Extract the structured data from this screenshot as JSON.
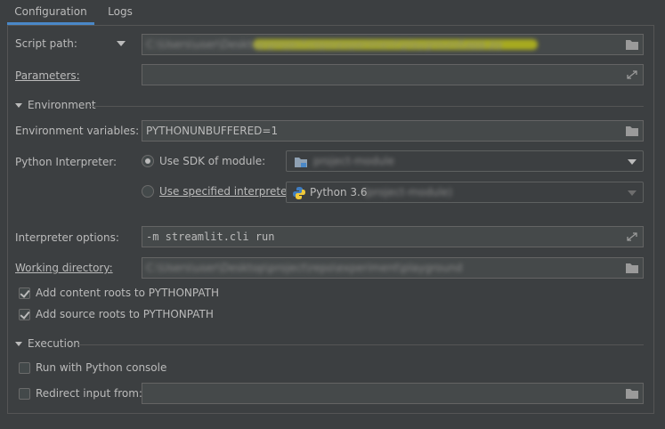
{
  "tabs": [
    {
      "label": "Configuration",
      "active": true
    },
    {
      "label": "Logs",
      "active": false
    }
  ],
  "script": {
    "label": "Script path:",
    "value": "C:\\Users\\user\\Desktop\\project\\repo\\experiment\\playground\\app.py"
  },
  "parameters": {
    "label": "Parameters:",
    "value": ""
  },
  "environment": {
    "title": "Environment",
    "env_vars_label": "Environment variables:",
    "env_vars_value": "PYTHONUNBUFFERED=1",
    "interpreter_label": "Python Interpreter:",
    "use_sdk_label": "Use SDK of module:",
    "module_value": "project-module",
    "use_specified_label": "Use specified interpreter:",
    "interpreter_value": "Python 3.6",
    "interpreter_value_suffix": "(project-module)",
    "interp_options_label": "Interpreter options:",
    "interp_options_value": "-m streamlit.cli run",
    "working_dir_label": "Working directory:",
    "working_dir_value": "C:\\Users\\user\\Desktop\\project\\repo\\experiment\\playground",
    "add_content_roots_label": "Add content roots to PYTHONPATH",
    "add_source_roots_label": "Add source roots to PYTHONPATH"
  },
  "execution": {
    "title": "Execution",
    "run_console_label": "Run with Python console",
    "redirect_label": "Redirect input from:",
    "redirect_value": ""
  },
  "colors": {
    "background": "#3c3f41",
    "field_bg": "#45494a",
    "accent": "#4a88c7",
    "text": "#bbbbbb",
    "highlight": "#cfd41c"
  }
}
